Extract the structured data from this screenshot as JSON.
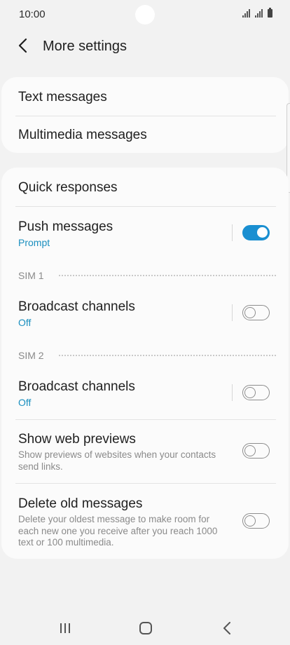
{
  "status_bar": {
    "time": "10:00"
  },
  "header": {
    "title": "More settings"
  },
  "card1": {
    "items": [
      {
        "label": "Text messages"
      },
      {
        "label": "Multimedia messages"
      }
    ]
  },
  "card2": {
    "quick_responses": {
      "label": "Quick responses"
    },
    "push_messages": {
      "label": "Push messages",
      "sub": "Prompt",
      "enabled": true
    },
    "sim1": {
      "label": "SIM 1",
      "broadcast": {
        "label": "Broadcast channels",
        "sub": "Off",
        "enabled": false
      }
    },
    "sim2": {
      "label": "SIM 2",
      "broadcast": {
        "label": "Broadcast channels",
        "sub": "Off",
        "enabled": false
      }
    },
    "web_previews": {
      "label": "Show web previews",
      "desc": "Show previews of websites when your contacts send links.",
      "enabled": false
    },
    "delete_old": {
      "label": "Delete old messages",
      "desc": "Delete your oldest message to make room for each new one you receive after you reach 1000 text or 100 multimedia.",
      "enabled": false
    }
  },
  "colors": {
    "accent": "#1a8fd1",
    "sub_text": "#1a8fbf",
    "background": "#f2f2f2",
    "card": "#fbfbfb"
  },
  "nav_bar": {
    "icons": [
      "recent-apps-icon",
      "home-icon",
      "back-icon"
    ]
  }
}
